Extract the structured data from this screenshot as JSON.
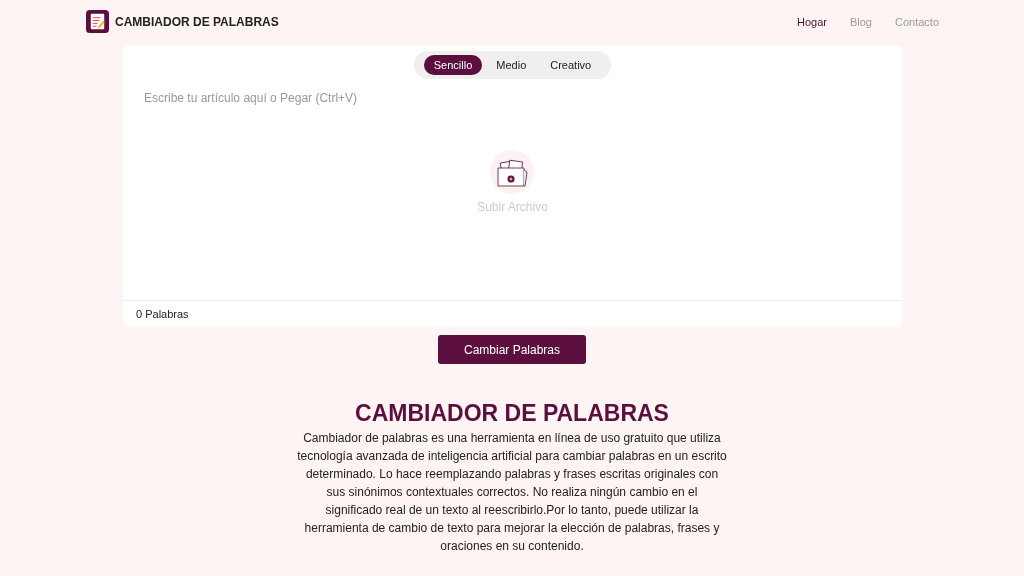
{
  "header": {
    "brand": "CAMBIADOR DE PALABRAS",
    "nav": [
      {
        "label": "Hogar",
        "selected": true
      },
      {
        "label": "Blog",
        "selected": false
      },
      {
        "label": "Contacto",
        "selected": false
      }
    ]
  },
  "editor": {
    "modes": [
      {
        "label": "Sencillo",
        "selected": true
      },
      {
        "label": "Medio",
        "selected": false
      },
      {
        "label": "Creativo",
        "selected": false
      }
    ],
    "placeholder": "Escribe tu artículo aquí o Pegar (Ctrl+V)",
    "upload_label": "Subir Archivo",
    "word_count": "0 Palabras"
  },
  "submit_button": "Cambiar Palabras",
  "about": {
    "heading": "CAMBIADOR DE PALABRAS",
    "body": "Cambiador de palabras es una herramienta en línea de uso gratuito que utiliza tecnología avanzada de inteligencia artificial para cambiar palabras en un escrito determinado. Lo hace reemplazando palabras y frases escritas originales con sus sinónimos contextuales correctos. No realiza ningún cambio en el significado real de un texto al reescribirlo.Por lo tanto, puede utilizar la herramienta de cambio de texto para mejorar la elección de palabras, frases y oraciones en su contenido."
  }
}
